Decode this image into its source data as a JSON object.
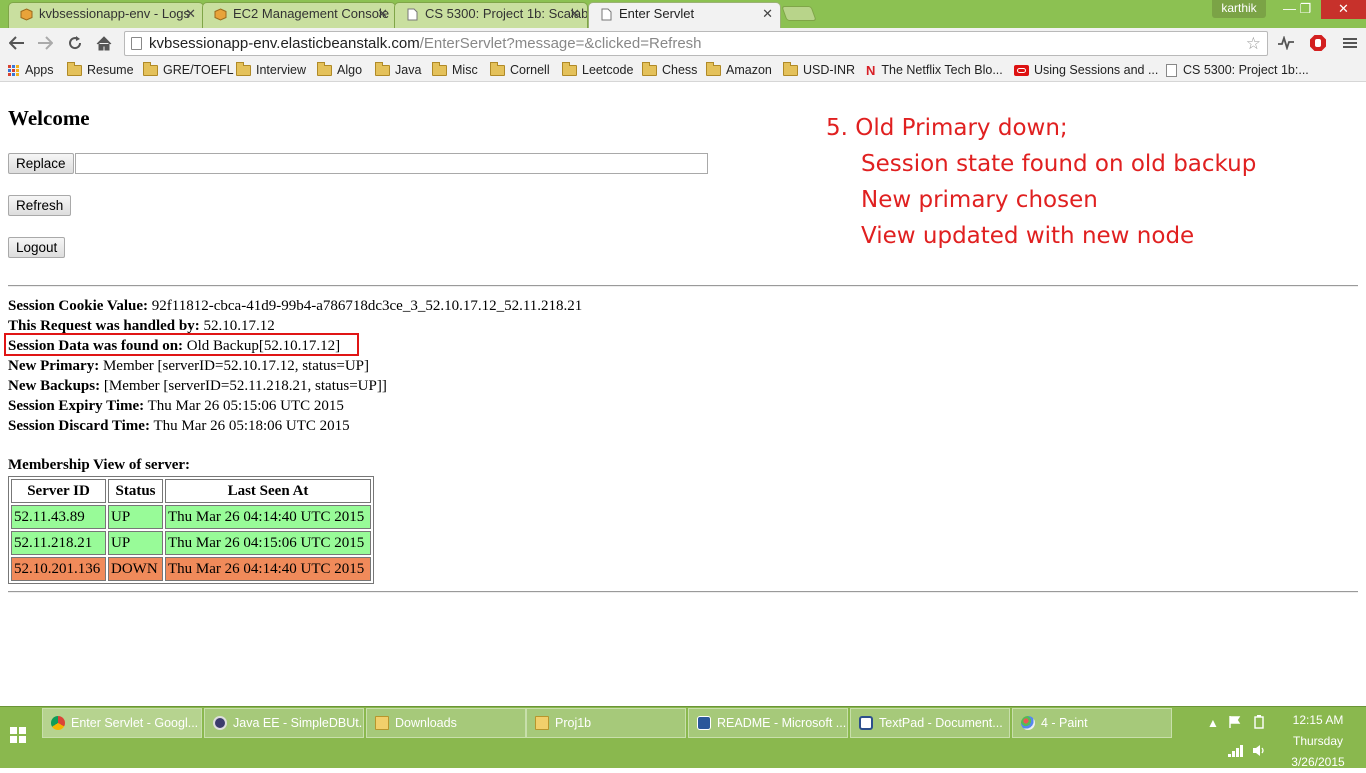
{
  "browser": {
    "tabs": [
      {
        "label": "kvbsessionapp-env - Logs",
        "icon": "aws-cube-icon",
        "active": false
      },
      {
        "label": "EC2 Management Console",
        "icon": "aws-cube-icon",
        "active": false
      },
      {
        "label": "CS 5300: Project 1b: Scalab",
        "icon": "document-icon",
        "active": false
      },
      {
        "label": "Enter Servlet",
        "icon": "document-icon",
        "active": true
      }
    ],
    "close_glyph": "✕",
    "user": "karthik",
    "window_controls": {
      "minimize": "—",
      "maximize": "❐",
      "close": "✕"
    },
    "url_host": "kvbsessionapp-env.elasticbeanstalk.com",
    "url_path": "/EnterServlet?message=&clicked=Refresh",
    "bookmarks": [
      {
        "label": "Apps",
        "icon": "apps-grid-icon"
      },
      {
        "label": "Resume",
        "icon": "folder-icon"
      },
      {
        "label": "GRE/TOEFL",
        "icon": "folder-icon"
      },
      {
        "label": "Interview",
        "icon": "folder-icon"
      },
      {
        "label": "Algo",
        "icon": "folder-icon"
      },
      {
        "label": "Java",
        "icon": "folder-icon"
      },
      {
        "label": "Misc",
        "icon": "folder-icon"
      },
      {
        "label": "Cornell",
        "icon": "folder-icon"
      },
      {
        "label": "Leetcode",
        "icon": "folder-icon"
      },
      {
        "label": "Chess",
        "icon": "folder-icon"
      },
      {
        "label": "Amazon",
        "icon": "folder-icon"
      },
      {
        "label": "USD-INR",
        "icon": "folder-icon"
      },
      {
        "label": "The Netflix Tech Blo...",
        "icon": "netflix-icon"
      },
      {
        "label": "Using Sessions and ...",
        "icon": "oracle-icon"
      },
      {
        "label": "CS 5300: Project 1b:...",
        "icon": "document-icon"
      }
    ]
  },
  "page": {
    "welcome": "Welcome",
    "replace_button": "Replace",
    "replace_value": "",
    "refresh_button": "Refresh",
    "logout_button": "Logout",
    "info": [
      {
        "label": "Session Cookie Value:",
        "value": " 92f11812-cbca-41d9-99b4-a786718dc3ce_3_52.10.17.12_52.11.218.21"
      },
      {
        "label": "This Request was handled by:",
        "value": " 52.10.17.12"
      },
      {
        "label": "Session Data was found on:",
        "value": " Old Backup[52.10.17.12]"
      },
      {
        "label": "New Primary:",
        "value": " Member [serverID=52.10.17.12, status=UP]"
      },
      {
        "label": "New Backups:",
        "value": " [Member [serverID=52.11.218.21, status=UP]]"
      },
      {
        "label": "Session Expiry Time:",
        "value": " Thu Mar 26 05:15:06 UTC 2015"
      },
      {
        "label": "Session Discard Time:",
        "value": " Thu Mar 26 05:18:06 UTC 2015"
      }
    ],
    "membership_title": "Membership View of server:",
    "membership_headers": [
      "Server ID",
      "Status",
      "Last Seen At"
    ],
    "membership_rows": [
      {
        "server_id": "52.11.43.89",
        "status": "UP",
        "last_seen": "Thu Mar 26 04:14:40 UTC 2015"
      },
      {
        "server_id": "52.11.218.21",
        "status": "UP",
        "last_seen": "Thu Mar 26 04:15:06 UTC 2015"
      },
      {
        "server_id": "52.10.201.136",
        "status": "DOWN",
        "last_seen": "Thu Mar 26 04:14:40 UTC 2015"
      }
    ],
    "status_colors": {
      "UP": "#98fb98",
      "DOWN": "#f08a5a"
    }
  },
  "annotation": {
    "color": "#e02020",
    "lines": [
      "5. Old Primary down;",
      "Session state found on old backup",
      "New primary chosen",
      "View updated with new node"
    ]
  },
  "taskbar": {
    "items": [
      {
        "label": "Enter Servlet - Googl...",
        "icon": "chrome-icon",
        "active": true
      },
      {
        "label": "Java EE - SimpleDBUt...",
        "icon": "eclipse-icon",
        "active": false
      },
      {
        "label": "Downloads",
        "icon": "folder-icon",
        "active": false
      },
      {
        "label": "Proj1b",
        "icon": "folder-icon",
        "active": false
      },
      {
        "label": "README - Microsoft ...",
        "icon": "word-icon",
        "active": false
      },
      {
        "label": "TextPad - Document...",
        "icon": "textpad-icon",
        "active": false
      },
      {
        "label": "4 - Paint",
        "icon": "paint-icon",
        "active": false
      }
    ],
    "time": "12:15 AM",
    "day": "Thursday",
    "date": "3/26/2015"
  }
}
